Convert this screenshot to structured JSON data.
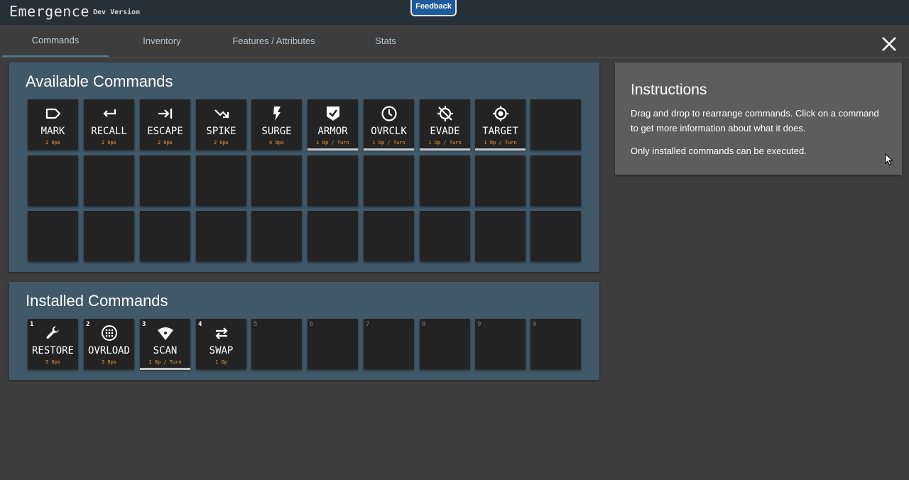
{
  "header": {
    "title": "Emergence",
    "subtitle": "Dev Version",
    "feedback_label": "Feedback"
  },
  "tabs": [
    {
      "label": "Commands",
      "active": true
    },
    {
      "label": "Inventory"
    },
    {
      "label": "Features / Attributes"
    },
    {
      "label": "Stats"
    }
  ],
  "available": {
    "title": "Available Commands",
    "commands": [
      {
        "name": "MARK",
        "cost": "2 Ops",
        "icon": "tag-icon",
        "bar": false
      },
      {
        "name": "RECALL",
        "cost": "2 Ops",
        "icon": "return-arrow-icon",
        "bar": false
      },
      {
        "name": "ESCAPE",
        "cost": "2 Ops",
        "icon": "arrow-to-right-icon",
        "bar": false
      },
      {
        "name": "SPIKE",
        "cost": "2 Ops",
        "icon": "trending-arrow-icon",
        "bar": false
      },
      {
        "name": "SURGE",
        "cost": "4 Ops",
        "icon": "lightning-icon",
        "bar": false
      },
      {
        "name": "ARMOR",
        "cost": "1 Op / Turn",
        "icon": "shield-check-icon",
        "bar": true
      },
      {
        "name": "OVRCLK",
        "cost": "1 Op / Turn",
        "icon": "clock-icon",
        "bar": true
      },
      {
        "name": "EVADE",
        "cost": "1 Op / Turn",
        "icon": "gps-off-icon",
        "bar": true
      },
      {
        "name": "TARGET",
        "cost": "1 Op / Turn",
        "icon": "crosshair-icon",
        "bar": true
      }
    ]
  },
  "installed": {
    "title": "Installed Commands",
    "slots": [
      {
        "num": "1",
        "name": "RESTORE",
        "cost": "5 Ops",
        "icon": "wrench-icon",
        "bar": false
      },
      {
        "num": "2",
        "name": "OVRLOAD",
        "cost": "3 Ops",
        "icon": "dotted-circle-icon",
        "bar": false
      },
      {
        "num": "3",
        "name": "SCAN",
        "cost": "1 Op / Turn",
        "icon": "wifi-scan-icon",
        "bar": true
      },
      {
        "num": "4",
        "name": "SWAP",
        "cost": "1 Op",
        "icon": "swap-arrows-icon",
        "bar": false
      },
      {
        "num": "5"
      },
      {
        "num": "6"
      },
      {
        "num": "7"
      },
      {
        "num": "8"
      },
      {
        "num": "9"
      },
      {
        "num": "0"
      }
    ]
  },
  "instructions": {
    "title": "Instructions",
    "p1": "Drag and drop to rearrange commands. Click on a command to get more information about what it does.",
    "p2": "Only installed commands can be executed."
  },
  "colors": {
    "topbar": "#263039",
    "panel": "#415868",
    "cell": "#232323",
    "cost": "#e8a24a",
    "tab_underline": "#4c7b8e",
    "feedback": "#1c5a9c"
  }
}
